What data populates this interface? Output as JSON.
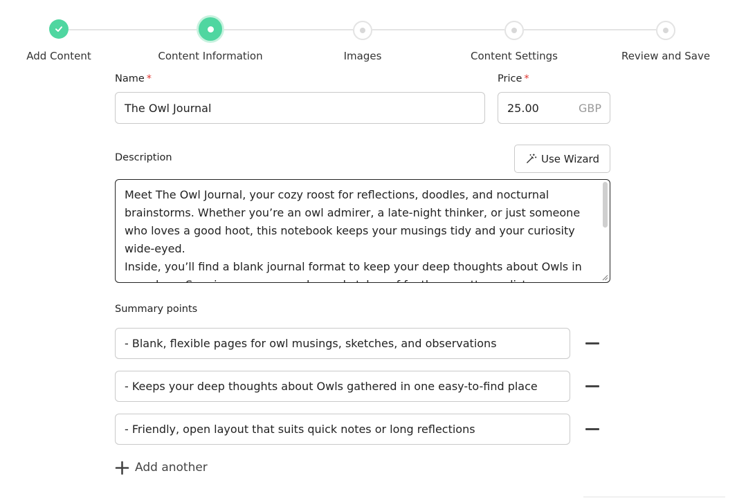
{
  "stepper": {
    "steps": [
      {
        "label": "Add Content",
        "state": "done"
      },
      {
        "label": "Content Information",
        "state": "current"
      },
      {
        "label": "Images",
        "state": "todo"
      },
      {
        "label": "Content Settings",
        "state": "todo"
      },
      {
        "label": "Review and Save",
        "state": "todo"
      }
    ]
  },
  "form": {
    "name_label": "Name",
    "name_value": "The Owl Journal",
    "price_label": "Price",
    "price_value": "25.00",
    "currency": "GBP",
    "required_mark": "*",
    "description_label": "Description",
    "wizard_label": "Use Wizard",
    "description_value": "Meet The Owl Journal, your cozy roost for reflections, doodles, and nocturnal brainstorms. Whether you’re an owl admirer, a late-night thinker, or just someone who loves a good hoot, this notebook keeps your musings tidy and your curiosity wide-eyed.\nInside, you’ll find a blank journal format to keep your deep thoughts about Owls in one place. Sore in your own words, or sketches of feathers, patterns, lists",
    "summary_label": "Summary points",
    "summary_points": [
      "- Blank, flexible pages for owl musings, sketches, and observations",
      "- Keeps your deep thoughts about Owls gathered in one easy-to-find place",
      "- Friendly, open layout that suits quick notes or long reflections"
    ],
    "add_another_label": "Add another"
  },
  "colors": {
    "accent": "#4fd6a0",
    "required": "#e0342f",
    "border": "#c9c9c9"
  }
}
